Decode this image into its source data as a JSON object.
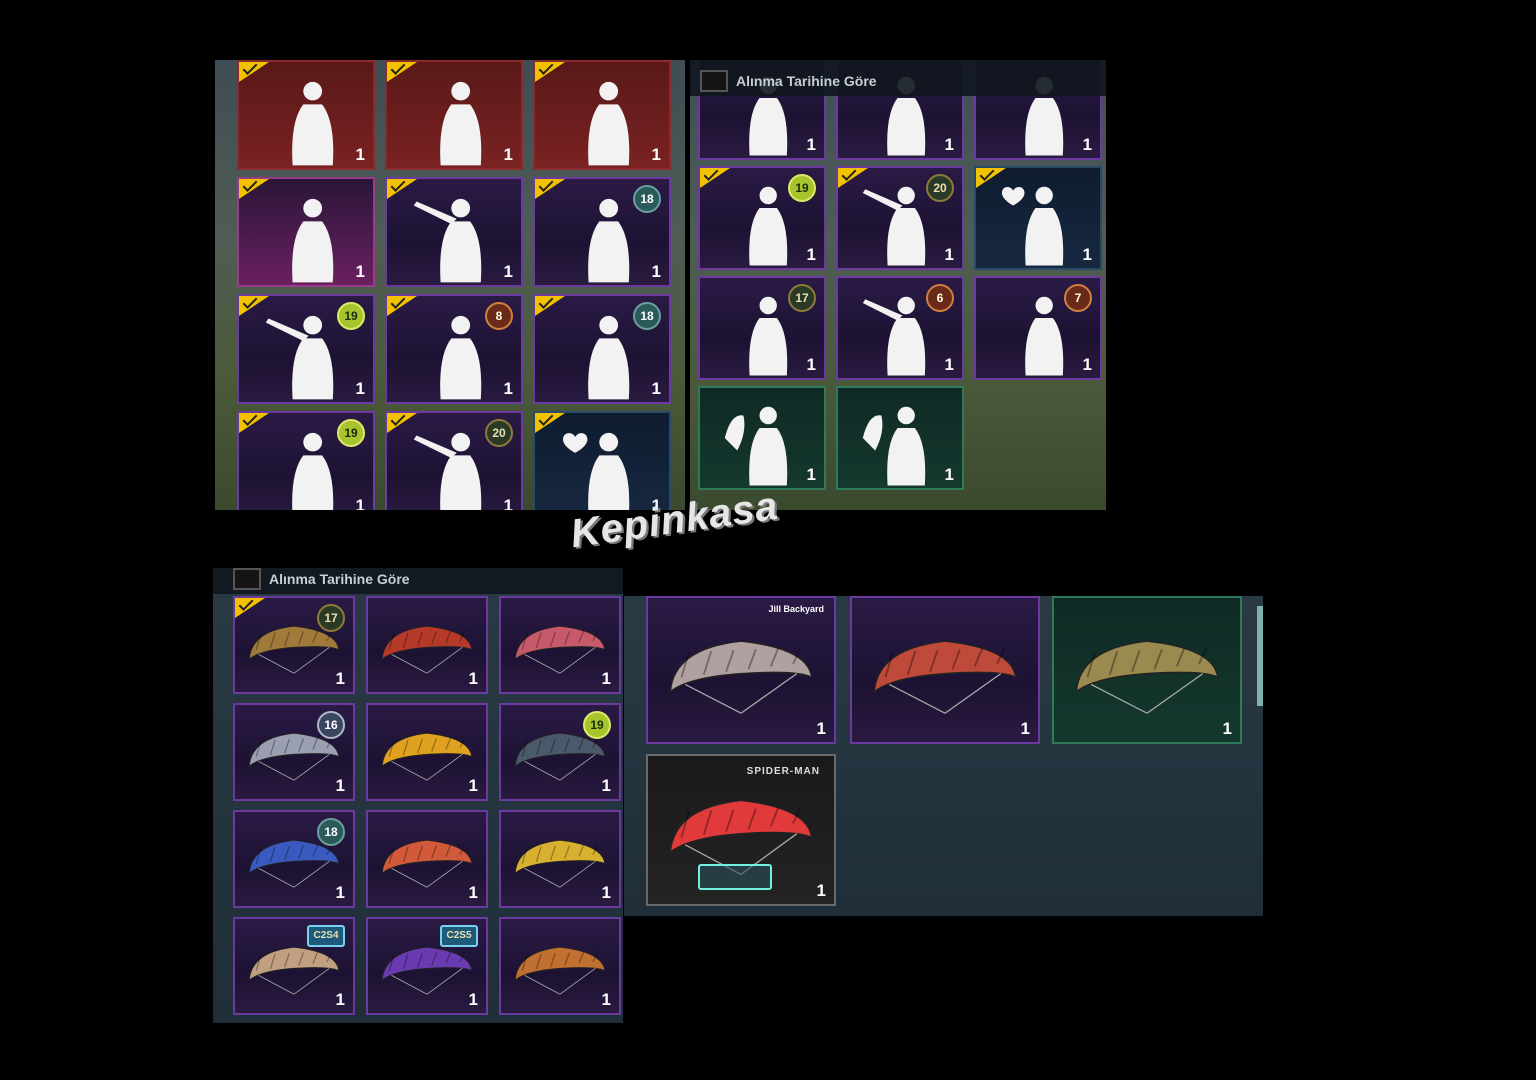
{
  "sort_label": "Alınma Tarihine Göre",
  "watermark": "Kepinkasa",
  "spider_label": "SPIDER-MAN",
  "corner_label": "Jill Backyard",
  "colors": {
    "check": "#f2c200",
    "rare_border": "#6a3aa0",
    "legendary_border": "#8a2a2a"
  },
  "emote_grid_a": [
    {
      "count": "1",
      "checked": true,
      "badge": "",
      "style": "red",
      "icon": "eagle-emote-icon"
    },
    {
      "count": "1",
      "checked": true,
      "badge": "",
      "style": "red",
      "icon": "salute-emote-icon"
    },
    {
      "count": "1",
      "checked": true,
      "badge": "",
      "style": "red",
      "icon": "hat-emote-icon"
    },
    {
      "count": "1",
      "checked": true,
      "badge": "",
      "style": "pink",
      "icon": "dance-emote-icon"
    },
    {
      "count": "1",
      "checked": true,
      "badge": "",
      "style": "purple",
      "icon": "arms-out-emote-icon"
    },
    {
      "count": "1",
      "checked": true,
      "badge": "18",
      "style": "purple",
      "icon": "shout-emote-icon"
    },
    {
      "count": "1",
      "checked": true,
      "badge": "19",
      "style": "purple",
      "icon": "point-emote-icon"
    },
    {
      "count": "1",
      "checked": true,
      "badge": "8",
      "style": "purple",
      "icon": "salute2-emote-icon"
    },
    {
      "count": "1",
      "checked": true,
      "badge": "18",
      "style": "purple",
      "icon": "music-emote-icon"
    },
    {
      "count": "1",
      "checked": true,
      "badge": "19",
      "style": "purple",
      "icon": "crouch-emote-icon"
    },
    {
      "count": "1",
      "checked": true,
      "badge": "20",
      "style": "purple",
      "icon": "pose-emote-icon"
    },
    {
      "count": "1",
      "checked": true,
      "badge": "",
      "style": "navy",
      "icon": "heart-emote-icon"
    }
  ],
  "emote_grid_b": [
    {
      "count": "1",
      "checked": false,
      "badge": "",
      "style": "purple",
      "icon": "wave-emote-icon"
    },
    {
      "count": "1",
      "checked": false,
      "badge": "",
      "style": "purple",
      "icon": "flex-emote-icon"
    },
    {
      "count": "1",
      "checked": false,
      "badge": "",
      "style": "purple",
      "icon": "music2-emote-icon"
    },
    {
      "count": "1",
      "checked": true,
      "badge": "19",
      "style": "purple",
      "icon": "crouch-emote-icon"
    },
    {
      "count": "1",
      "checked": true,
      "badge": "20",
      "style": "purple",
      "icon": "pose-emote-icon"
    },
    {
      "count": "1",
      "checked": true,
      "badge": "",
      "style": "navy",
      "icon": "heart-emote-icon"
    },
    {
      "count": "1",
      "checked": false,
      "badge": "17",
      "style": "purple",
      "icon": "lunge-emote-icon"
    },
    {
      "count": "1",
      "checked": false,
      "badge": "6",
      "style": "purple",
      "icon": "dab-emote-icon"
    },
    {
      "count": "1",
      "checked": false,
      "badge": "7",
      "style": "purple",
      "icon": "think-emote-icon"
    },
    {
      "count": "1",
      "checked": false,
      "badge": "",
      "style": "green",
      "icon": "hello-emote-icon"
    },
    {
      "count": "1",
      "checked": false,
      "badge": "",
      "style": "green",
      "icon": "clap-emote-icon"
    }
  ],
  "parachutes_a": [
    {
      "count": "1",
      "checked": true,
      "badge": "17",
      "color": "#a07a3a",
      "icon": "parachute-icon"
    },
    {
      "count": "1",
      "checked": false,
      "badge": "",
      "color": "#b53a2a",
      "icon": "parachute-icon"
    },
    {
      "count": "1",
      "checked": false,
      "badge": "",
      "color": "#c65a6a",
      "icon": "parachute-icon"
    },
    {
      "count": "1",
      "checked": false,
      "badge": "16",
      "color": "#9aa0b0",
      "icon": "parachute-icon"
    },
    {
      "count": "1",
      "checked": false,
      "badge": "",
      "color": "#e0a020",
      "icon": "parachute-icon"
    },
    {
      "count": "1",
      "checked": false,
      "badge": "19",
      "color": "#4a5a6a",
      "icon": "parachute-icon"
    },
    {
      "count": "1",
      "checked": false,
      "badge": "18",
      "color": "#3a5ac0",
      "icon": "parachute-icon"
    },
    {
      "count": "1",
      "checked": false,
      "badge": "",
      "color": "#d05a3a",
      "icon": "parachute-icon"
    },
    {
      "count": "1",
      "checked": false,
      "badge": "",
      "color": "#d8b030",
      "icon": "parachute-icon"
    },
    {
      "count": "1",
      "checked": false,
      "badge": "C2S4",
      "color": "#c0a080",
      "icon": "parachute-icon"
    },
    {
      "count": "1",
      "checked": false,
      "badge": "C2S5",
      "color": "#6a3ab0",
      "icon": "parachute-icon"
    },
    {
      "count": "1",
      "checked": false,
      "badge": "",
      "color": "#c07030",
      "icon": "parachute-icon"
    }
  ],
  "parachutes_b": [
    {
      "count": "1",
      "color": "#b0a0a0",
      "style": "purple",
      "icon": "parachute-icon"
    },
    {
      "count": "1",
      "color": "#c04a3a",
      "style": "purple",
      "icon": "parachute-icon"
    },
    {
      "count": "1",
      "color": "#9a8a50",
      "style": "green",
      "icon": "parachute-icon"
    },
    {
      "count": "1",
      "color": "#e03a3a",
      "style": "gray",
      "icon": "parachute-icon"
    }
  ]
}
